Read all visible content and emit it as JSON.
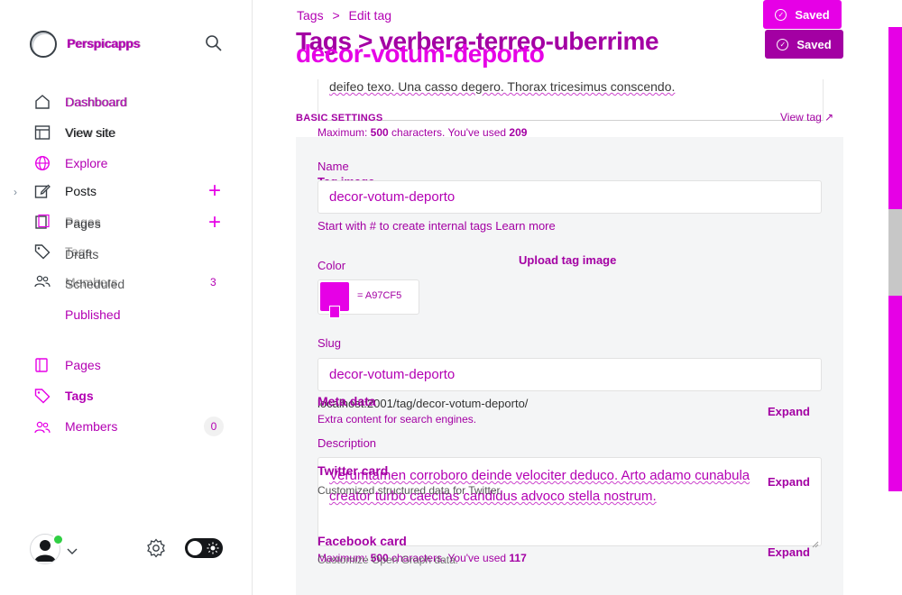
{
  "site": {
    "title": "Perspicapps",
    "title_ghost": "Perspicapps"
  },
  "sidebar": {
    "dashboard": "Dashboard",
    "dashboard_ghost": "Dashboard",
    "view_site": "View site",
    "view_site_ghost": "View site",
    "explore": "Explore",
    "posts": "Posts",
    "pages_ghost": "Pages",
    "pages_ghost2": "Pages",
    "tags_ghost": "Tags",
    "drafts_ghost": "Drafts",
    "members_ghost": "Members",
    "scheduled_ghost": "Scheduled",
    "scheduled_count": "3",
    "published": "Published",
    "pages": "Pages",
    "tags": "Tags",
    "members": "Members",
    "members_count": "0"
  },
  "breadcrumb": {
    "parent": "Tags",
    "sep": ">",
    "current": "Edit tag"
  },
  "title": {
    "line1": "Tags > verbera-terreo-uberrime",
    "line2": "decor-votum-deporto"
  },
  "buttons": {
    "saved_top": "Saved",
    "saved": "Saved"
  },
  "top_card": {
    "tail_text": "deifeo texo. Una casso degero. Thorax tricesimus conscendo."
  },
  "basic_settings": "BASIC SETTINGS",
  "view_tag": "View tag ↗",
  "max_note": {
    "prefix": "Maximum: ",
    "max": "500",
    "mid": " characters. You've used ",
    "used": "209"
  },
  "form": {
    "name_label": "Name",
    "tag_image_label": "Tag image",
    "name_value": "decor-votum-deporto",
    "name_hint": "Start with # to create internal tags Learn more",
    "upload": "Upload tag image",
    "color_label": "Color",
    "color_value": "= A97CF5",
    "color_hex": "#e600e6",
    "slug_label": "Slug",
    "slug_value": "decor-votum-deporto",
    "slug_url": "localhost:2001/tag/decor-votum-deporto/",
    "description_label": "Description",
    "description_value": "Verumtamen corroboro deinde velociter deduco. Arto adamo cunabula creator turbo caecitas candidus advoco stella nostrum.",
    "desc_note": {
      "prefix": "Maximum: ",
      "max": "500",
      "mid": " characters. You've used ",
      "used": "117"
    }
  },
  "sections": {
    "meta_title": "Meta data",
    "meta_sub": "Extra content for search engines.",
    "twitter_title": "Twitter card",
    "twitter_sub": "Customized structured data for Twitter.",
    "facebook_title": "Facebook card",
    "facebook_sub": "Customize Open Graph data.",
    "expand": "Expand"
  }
}
